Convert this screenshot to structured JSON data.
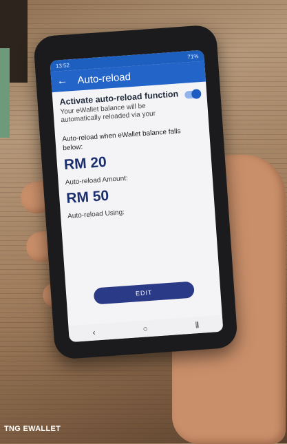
{
  "status_bar": {
    "time": "13:52",
    "battery": "71%"
  },
  "app_bar": {
    "back_icon": "back-arrow-icon",
    "title": "Auto-reload"
  },
  "auto_reload": {
    "toggle_title": "Activate auto-reload function",
    "toggle_description": "Your eWallet balance will be automatically reloaded via your",
    "toggle_on": true,
    "threshold_label": "Auto-reload when eWallet balance falls below:",
    "threshold_value": "RM 20",
    "amount_label": "Auto-reload Amount:",
    "amount_value": "RM 50",
    "using_label": "Auto-reload Using:",
    "edit_button": "EDIT"
  },
  "nav_bar": {
    "back": "‹",
    "home": "○",
    "recents": "⦀"
  },
  "caption": "TNG EWALLET",
  "colors": {
    "primary": "#2364c8",
    "button": "#2b3a86",
    "value_text": "#1c2f6f"
  }
}
